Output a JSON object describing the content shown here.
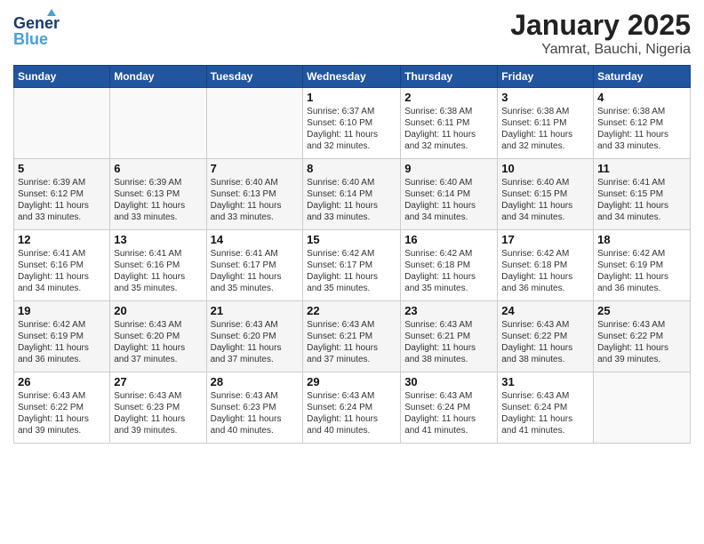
{
  "header": {
    "logo_line1": "General",
    "logo_line2": "Blue",
    "title": "January 2025",
    "subtitle": "Yamrat, Bauchi, Nigeria"
  },
  "weekdays": [
    "Sunday",
    "Monday",
    "Tuesday",
    "Wednesday",
    "Thursday",
    "Friday",
    "Saturday"
  ],
  "weeks": [
    [
      {
        "day": "",
        "info": ""
      },
      {
        "day": "",
        "info": ""
      },
      {
        "day": "",
        "info": ""
      },
      {
        "day": "1",
        "info": "Sunrise: 6:37 AM\nSunset: 6:10 PM\nDaylight: 11 hours\nand 32 minutes."
      },
      {
        "day": "2",
        "info": "Sunrise: 6:38 AM\nSunset: 6:11 PM\nDaylight: 11 hours\nand 32 minutes."
      },
      {
        "day": "3",
        "info": "Sunrise: 6:38 AM\nSunset: 6:11 PM\nDaylight: 11 hours\nand 32 minutes."
      },
      {
        "day": "4",
        "info": "Sunrise: 6:38 AM\nSunset: 6:12 PM\nDaylight: 11 hours\nand 33 minutes."
      }
    ],
    [
      {
        "day": "5",
        "info": "Sunrise: 6:39 AM\nSunset: 6:12 PM\nDaylight: 11 hours\nand 33 minutes."
      },
      {
        "day": "6",
        "info": "Sunrise: 6:39 AM\nSunset: 6:13 PM\nDaylight: 11 hours\nand 33 minutes."
      },
      {
        "day": "7",
        "info": "Sunrise: 6:40 AM\nSunset: 6:13 PM\nDaylight: 11 hours\nand 33 minutes."
      },
      {
        "day": "8",
        "info": "Sunrise: 6:40 AM\nSunset: 6:14 PM\nDaylight: 11 hours\nand 33 minutes."
      },
      {
        "day": "9",
        "info": "Sunrise: 6:40 AM\nSunset: 6:14 PM\nDaylight: 11 hours\nand 34 minutes."
      },
      {
        "day": "10",
        "info": "Sunrise: 6:40 AM\nSunset: 6:15 PM\nDaylight: 11 hours\nand 34 minutes."
      },
      {
        "day": "11",
        "info": "Sunrise: 6:41 AM\nSunset: 6:15 PM\nDaylight: 11 hours\nand 34 minutes."
      }
    ],
    [
      {
        "day": "12",
        "info": "Sunrise: 6:41 AM\nSunset: 6:16 PM\nDaylight: 11 hours\nand 34 minutes."
      },
      {
        "day": "13",
        "info": "Sunrise: 6:41 AM\nSunset: 6:16 PM\nDaylight: 11 hours\nand 35 minutes."
      },
      {
        "day": "14",
        "info": "Sunrise: 6:41 AM\nSunset: 6:17 PM\nDaylight: 11 hours\nand 35 minutes."
      },
      {
        "day": "15",
        "info": "Sunrise: 6:42 AM\nSunset: 6:17 PM\nDaylight: 11 hours\nand 35 minutes."
      },
      {
        "day": "16",
        "info": "Sunrise: 6:42 AM\nSunset: 6:18 PM\nDaylight: 11 hours\nand 35 minutes."
      },
      {
        "day": "17",
        "info": "Sunrise: 6:42 AM\nSunset: 6:18 PM\nDaylight: 11 hours\nand 36 minutes."
      },
      {
        "day": "18",
        "info": "Sunrise: 6:42 AM\nSunset: 6:19 PM\nDaylight: 11 hours\nand 36 minutes."
      }
    ],
    [
      {
        "day": "19",
        "info": "Sunrise: 6:42 AM\nSunset: 6:19 PM\nDaylight: 11 hours\nand 36 minutes."
      },
      {
        "day": "20",
        "info": "Sunrise: 6:43 AM\nSunset: 6:20 PM\nDaylight: 11 hours\nand 37 minutes."
      },
      {
        "day": "21",
        "info": "Sunrise: 6:43 AM\nSunset: 6:20 PM\nDaylight: 11 hours\nand 37 minutes."
      },
      {
        "day": "22",
        "info": "Sunrise: 6:43 AM\nSunset: 6:21 PM\nDaylight: 11 hours\nand 37 minutes."
      },
      {
        "day": "23",
        "info": "Sunrise: 6:43 AM\nSunset: 6:21 PM\nDaylight: 11 hours\nand 38 minutes."
      },
      {
        "day": "24",
        "info": "Sunrise: 6:43 AM\nSunset: 6:22 PM\nDaylight: 11 hours\nand 38 minutes."
      },
      {
        "day": "25",
        "info": "Sunrise: 6:43 AM\nSunset: 6:22 PM\nDaylight: 11 hours\nand 39 minutes."
      }
    ],
    [
      {
        "day": "26",
        "info": "Sunrise: 6:43 AM\nSunset: 6:22 PM\nDaylight: 11 hours\nand 39 minutes."
      },
      {
        "day": "27",
        "info": "Sunrise: 6:43 AM\nSunset: 6:23 PM\nDaylight: 11 hours\nand 39 minutes."
      },
      {
        "day": "28",
        "info": "Sunrise: 6:43 AM\nSunset: 6:23 PM\nDaylight: 11 hours\nand 40 minutes."
      },
      {
        "day": "29",
        "info": "Sunrise: 6:43 AM\nSunset: 6:24 PM\nDaylight: 11 hours\nand 40 minutes."
      },
      {
        "day": "30",
        "info": "Sunrise: 6:43 AM\nSunset: 6:24 PM\nDaylight: 11 hours\nand 41 minutes."
      },
      {
        "day": "31",
        "info": "Sunrise: 6:43 AM\nSunset: 6:24 PM\nDaylight: 11 hours\nand 41 minutes."
      },
      {
        "day": "",
        "info": ""
      }
    ]
  ]
}
